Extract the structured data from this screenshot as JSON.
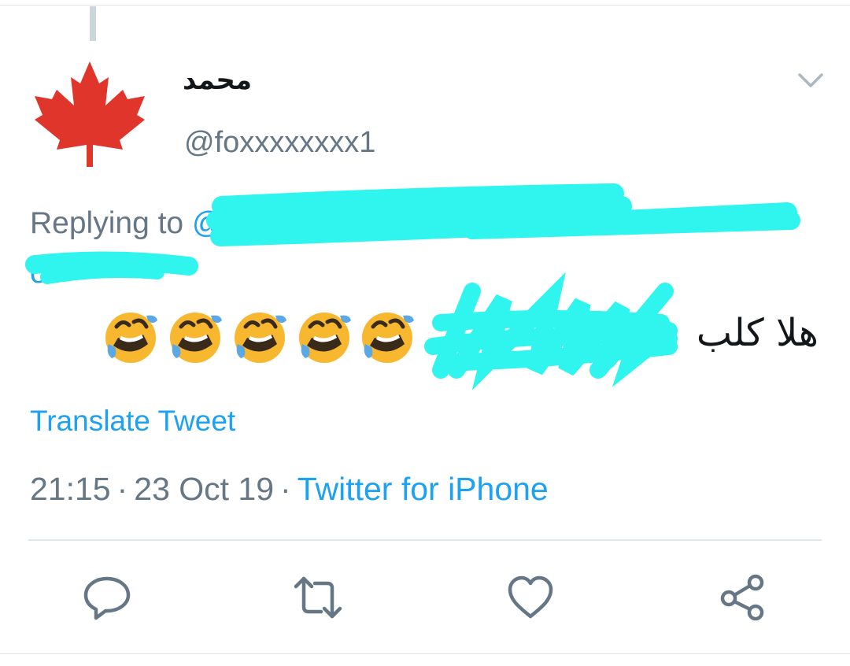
{
  "tweet": {
    "display_name": "محمد",
    "handle": "@foxxxxxxxx1",
    "replying_prefix": "Replying to",
    "replying_to_handle": "@",
    "replying_line2": "ot",
    "text": "هلا كلب",
    "emoji": [
      "face-with-tears-of-joy-rolling",
      "face-with-tears-of-joy-rolling",
      "face-with-tears-of-joy-rolling",
      "face-with-tears-of-joy-rolling",
      "face-with-tears-of-joy-rolling"
    ],
    "translate_label": "Translate Tweet",
    "time": "21:15",
    "date": "23 Oct 19",
    "separator": "·",
    "source": "Twitter for iPhone"
  },
  "actions": {
    "reply_icon": "reply-icon",
    "retweet_icon": "retweet-icon",
    "like_icon": "heart-icon",
    "share_icon": "share-icon"
  },
  "colors": {
    "link_blue": "#1da1f2",
    "secondary_gray": "#657786",
    "primary_text": "#14171a",
    "redaction_cyan": "#2ff5ee",
    "maple_red": "#e0352b"
  }
}
